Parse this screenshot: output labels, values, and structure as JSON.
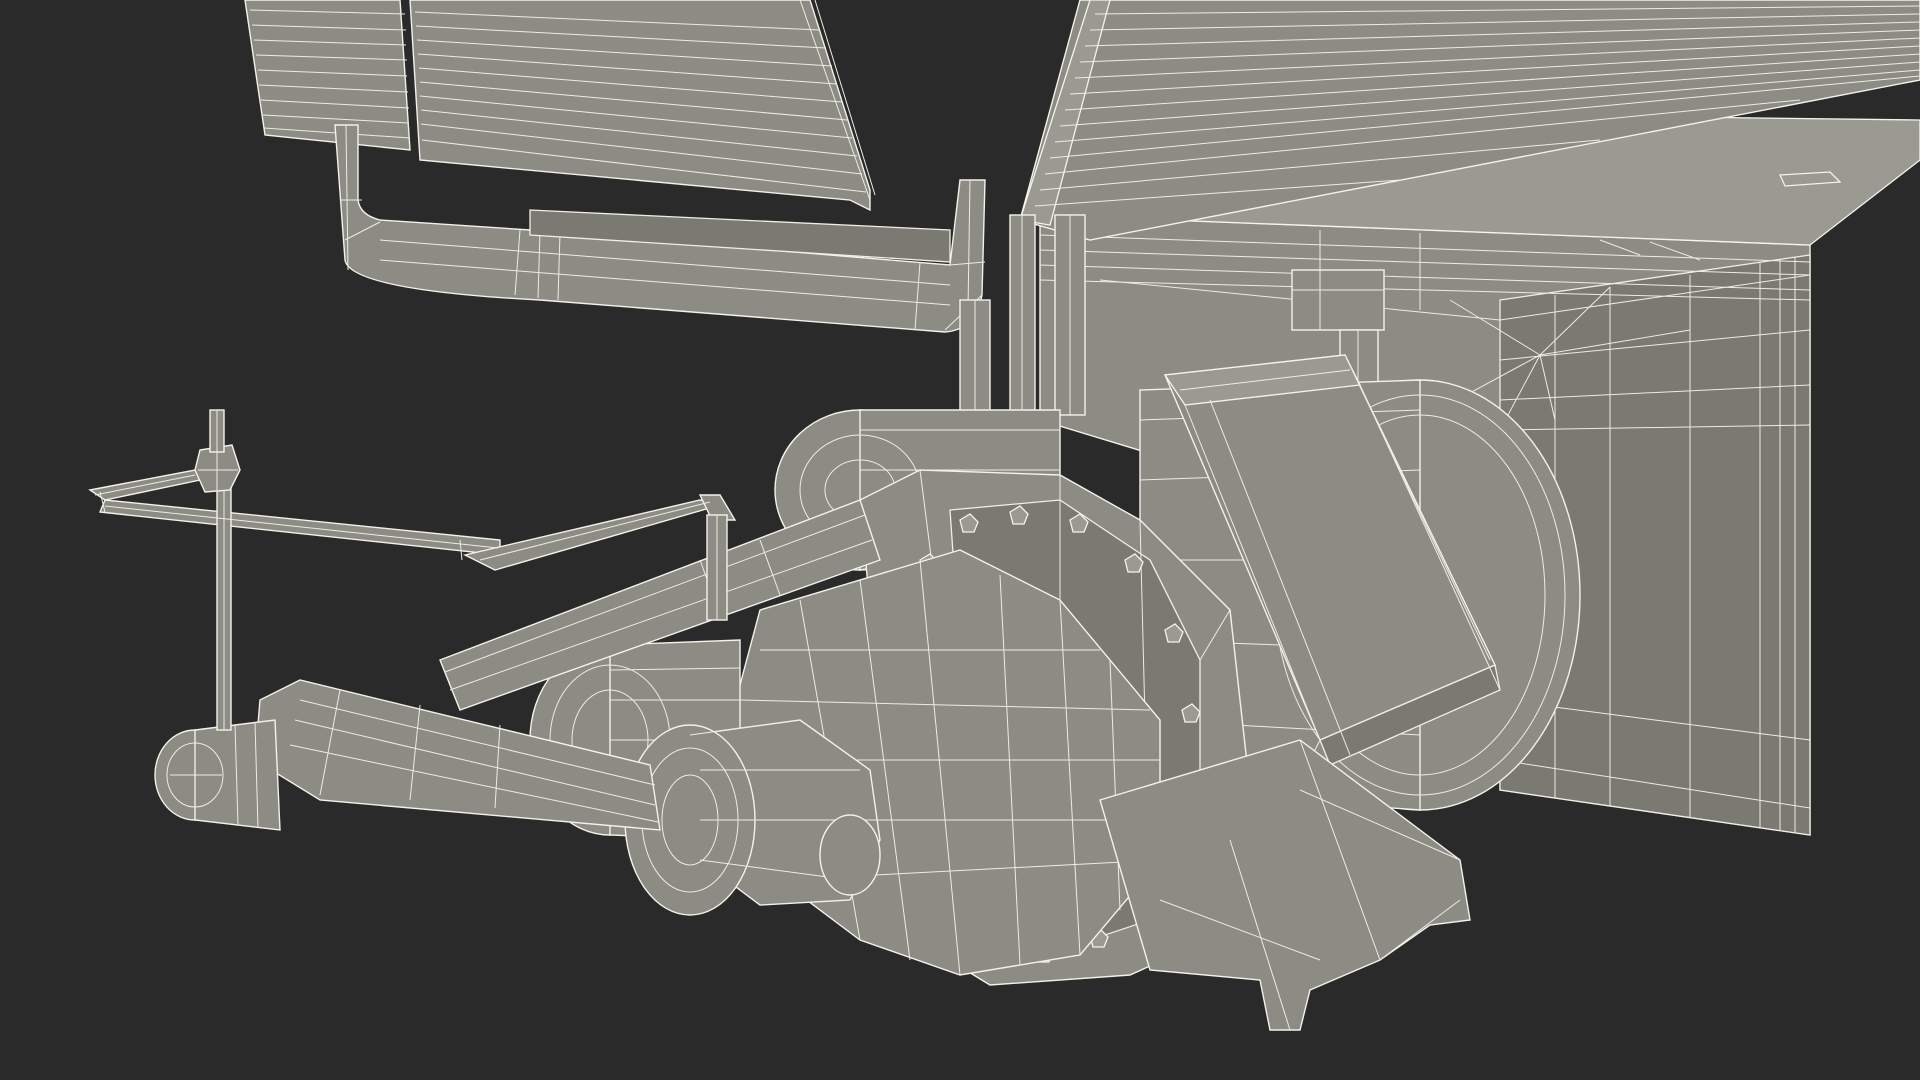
{
  "scene": {
    "background_color": "#2a2a2a",
    "model_fill_color": "#8c8c84",
    "wireframe_color": "#f2f2ea"
  }
}
